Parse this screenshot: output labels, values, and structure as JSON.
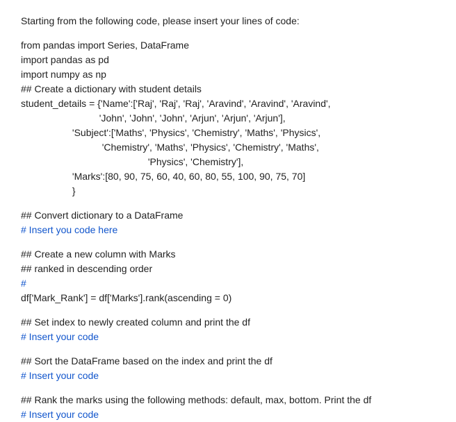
{
  "intro": "Starting from the following code, please insert your lines of code:",
  "codeblock": {
    "l1": "from pandas import Series, DataFrame",
    "l2": "import pandas as pd",
    "l3": "import numpy as np",
    "l4": "## Create a dictionary with student details",
    "l5": "student_details = {'Name':['Raj', 'Raj', 'Raj', 'Aravind', 'Aravind', 'Aravind',",
    "l6": "                             'John', 'John', 'John', 'Arjun', 'Arjun', 'Arjun'],",
    "l7": "                   'Subject':['Maths', 'Physics', 'Chemistry', 'Maths', 'Physics',",
    "l8": "                              'Chemistry', 'Maths', 'Physics', 'Chemistry', 'Maths',",
    "l9": "                                               'Physics', 'Chemistry'],",
    "l10": "                   'Marks':[80, 90, 75, 60, 40, 60, 80, 55, 100, 90, 75, 70]",
    "l11": "                   }"
  },
  "sec1": {
    "c1": "## Convert dictionary to a DataFrame",
    "c2": "# Insert you code here"
  },
  "sec2": {
    "c1": "## Create a new column with Marks",
    "c2": "## ranked in descending order",
    "c3": "# ",
    "c4": "df['Mark_Rank'] = df['Marks'].rank(ascending = 0)"
  },
  "sec3": {
    "c1": "## Set index to newly created column and print the df",
    "c2": "# Insert your code"
  },
  "sec4": {
    "c1": "## Sort the DataFrame based on the index and print the df",
    "c2": "# Insert your code"
  },
  "sec5": {
    "c1": "## Rank the marks using the following methods: default, max, bottom. Print the df",
    "c2": "# Insert your code"
  }
}
